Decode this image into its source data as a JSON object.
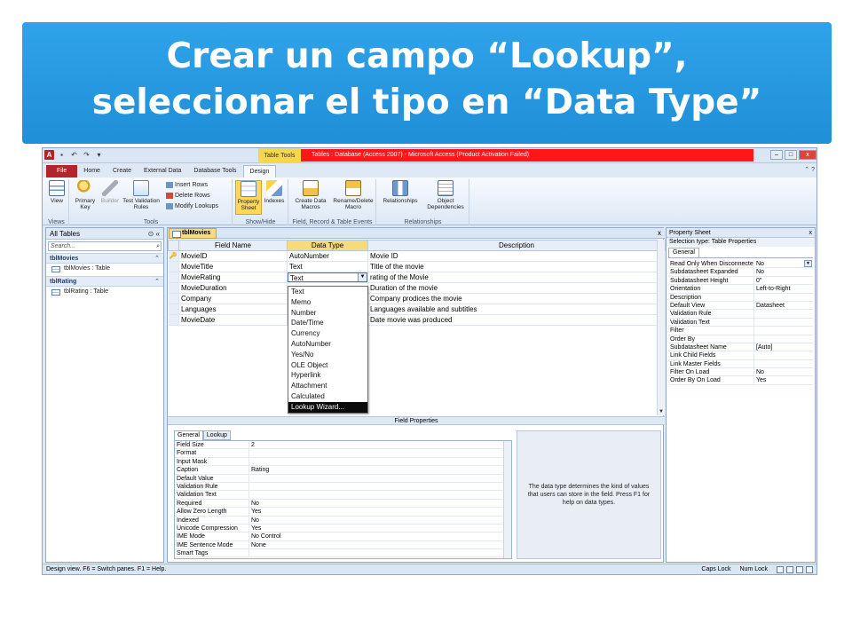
{
  "slide": {
    "title_line1": "Crear un campo “Lookup”,",
    "title_line2": "seleccionar el tipo en “Data Type”"
  },
  "window": {
    "context_tab": "Table Tools",
    "title": "Tables : Database (Access 2007) - Microsoft Access (Product Activation Failed)",
    "qat_app": "A",
    "controls": [
      "–",
      "□",
      "x"
    ]
  },
  "tabs": {
    "file": "File",
    "home": "Home",
    "create": "Create",
    "external": "External Data",
    "dbtools": "Database Tools",
    "design": "Design"
  },
  "ribbon": {
    "views": {
      "view": "View",
      "group": "Views"
    },
    "tools": {
      "primary_key": "Primary Key",
      "builder": "Builder",
      "test_rules": "Test Validation Rules",
      "insert_rows": "Insert Rows",
      "delete_rows": "Delete Rows",
      "modify_lookups": "Modify Lookups",
      "group": "Tools"
    },
    "showhide": {
      "property_sheet": "Property Sheet",
      "indexes": "Indexes",
      "group": "Show/Hide"
    },
    "events": {
      "create_macros": "Create Data Macros",
      "rename_delete": "Rename/Delete Macro",
      "group": "Field, Record & Table Events"
    },
    "relationships": {
      "relationships": "Relationships",
      "object_dependencies": "Object Dependencies",
      "group": "Relationships"
    }
  },
  "nav": {
    "header": "All Tables",
    "search_placeholder": "Search...",
    "groups": [
      {
        "name": "tblMovies",
        "item": "tblMovies : Table"
      },
      {
        "name": "tblRating",
        "item": "tblRating : Table"
      }
    ]
  },
  "doc": {
    "tab": "tblMovies",
    "close": "x",
    "headers": {
      "field": "Field Name",
      "type": "Data Type",
      "desc": "Description"
    },
    "rows": [
      {
        "field": "MovieID",
        "type": "AutoNumber",
        "desc": "Movie ID"
      },
      {
        "field": "MovieTitle",
        "type": "Text",
        "desc": "Title of the movie"
      },
      {
        "field": "MovieRating",
        "type": "Text",
        "desc": "rating of the Movie"
      },
      {
        "field": "MovieDuration",
        "type": "",
        "desc": "Duration of the movie"
      },
      {
        "field": "Company",
        "type": "",
        "desc": "Company prodices the movie"
      },
      {
        "field": "Languages",
        "type": "",
        "desc": "Languages available and subtitles"
      },
      {
        "field": "MovieDate",
        "type": "",
        "desc": "Date movie was produced"
      }
    ],
    "dropdown": [
      "Text",
      "Memo",
      "Number",
      "Date/Time",
      "Currency",
      "AutoNumber",
      "Yes/No",
      "OLE Object",
      "Hyperlink",
      "Attachment",
      "Calculated",
      "Lookup Wizard..."
    ],
    "dropdown_selected": "Lookup Wizard...",
    "field_properties_label": "Field Properties",
    "fp_tabs": [
      "General",
      "Lookup"
    ],
    "fp_rows": [
      {
        "k": "Field Size",
        "v": "2"
      },
      {
        "k": "Format",
        "v": ""
      },
      {
        "k": "Input Mask",
        "v": ""
      },
      {
        "k": "Caption",
        "v": "Rating"
      },
      {
        "k": "Default Value",
        "v": ""
      },
      {
        "k": "Validation Rule",
        "v": ""
      },
      {
        "k": "Validation Text",
        "v": ""
      },
      {
        "k": "Required",
        "v": "No"
      },
      {
        "k": "Allow Zero Length",
        "v": "Yes"
      },
      {
        "k": "Indexed",
        "v": "No"
      },
      {
        "k": "Unicode Compression",
        "v": "Yes"
      },
      {
        "k": "IME Mode",
        "v": "No Control"
      },
      {
        "k": "IME Sentence Mode",
        "v": "None"
      },
      {
        "k": "Smart Tags",
        "v": ""
      }
    ],
    "help_text": "The data type determines the kind of values that users can store in the field. Press F1 for help on data types."
  },
  "property_sheet": {
    "title": "Property Sheet",
    "close": "x",
    "selection": "Selection type:  Table Properties",
    "tab": "General",
    "rows": [
      {
        "k": "Read Only When Disconnected",
        "v": "No"
      },
      {
        "k": "Subdatasheet Expanded",
        "v": "No"
      },
      {
        "k": "Subdatasheet Height",
        "v": "0\""
      },
      {
        "k": "Orientation",
        "v": "Left-to-Right"
      },
      {
        "k": "Description",
        "v": ""
      },
      {
        "k": "Default View",
        "v": "Datasheet"
      },
      {
        "k": "Validation Rule",
        "v": ""
      },
      {
        "k": "Validation Text",
        "v": ""
      },
      {
        "k": "Filter",
        "v": ""
      },
      {
        "k": "Order By",
        "v": ""
      },
      {
        "k": "Subdatasheet Name",
        "v": "[Auto]"
      },
      {
        "k": "Link Child Fields",
        "v": ""
      },
      {
        "k": "Link Master Fields",
        "v": ""
      },
      {
        "k": "Filter On Load",
        "v": "No"
      },
      {
        "k": "Order By On Load",
        "v": "Yes"
      }
    ]
  },
  "status": {
    "left": "Design view.  F6 = Switch panes.  F1 = Help.",
    "caps": "Caps Lock",
    "num": "Num Lock"
  }
}
